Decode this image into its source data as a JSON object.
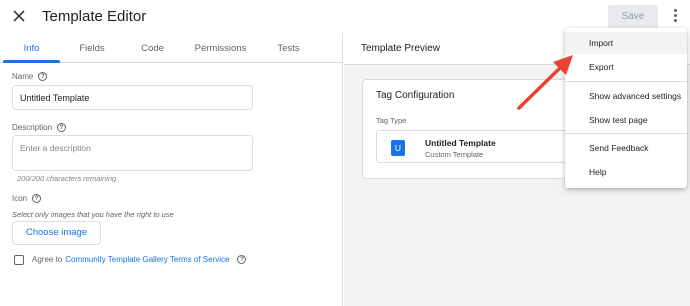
{
  "header": {
    "title": "Template Editor",
    "save_label": "Save"
  },
  "tabs": [
    "Info",
    "Fields",
    "Code",
    "Permissions",
    "Tests"
  ],
  "info": {
    "name_label": "Name",
    "name_value": "Untitled Template",
    "description_label": "Description",
    "description_placeholder": "Enter a description",
    "char_count": "200/200 characters remaining",
    "icon_label": "Icon",
    "icon_hint": "Select only images that you have the right to use",
    "choose_image_label": "Choose image",
    "agree_prefix": "Agree to",
    "agree_link": "Community Template Gallery Terms of Service"
  },
  "preview": {
    "title": "Template Preview",
    "card_title": "Tag Configuration",
    "tag_type_label": "Tag Type",
    "tag_icon_letter": "U",
    "tag_name": "Untitled Template",
    "tag_subtitle": "Custom Template"
  },
  "menu": {
    "items": [
      "Import",
      "Export",
      "Show advanced settings",
      "Show test page",
      "Send Feedback",
      "Help"
    ]
  },
  "colors": {
    "accent": "#1a73e8",
    "annotation_arrow": "#ea4335"
  }
}
